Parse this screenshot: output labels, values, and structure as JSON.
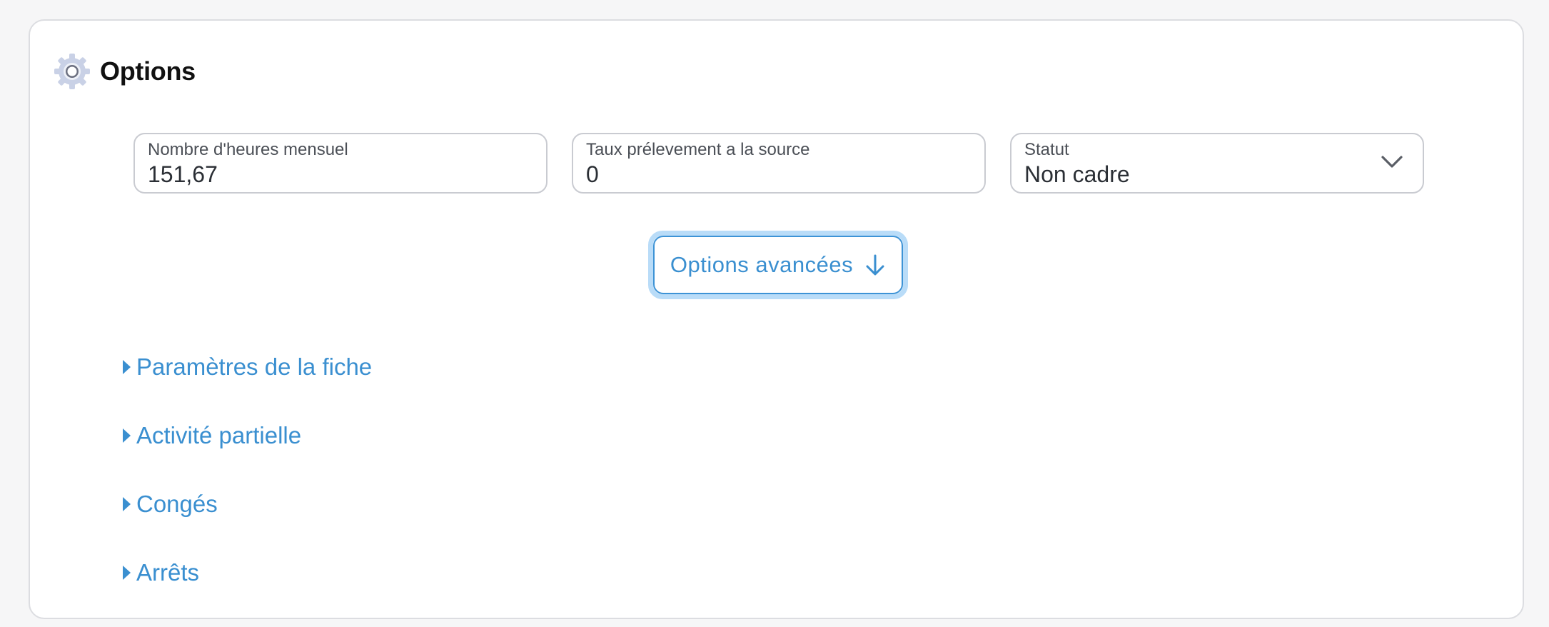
{
  "header": {
    "title": "Options",
    "icon": "gear-icon"
  },
  "fields": [
    {
      "label": "Nombre d'heures mensuel",
      "value": "151,67"
    },
    {
      "label": "Taux prélevement a la source",
      "value": "0"
    },
    {
      "label": "Statut",
      "value": "Non cadre",
      "type": "select"
    }
  ],
  "advanced_button": {
    "label": "Options avancées",
    "icon": "arrow-down-icon"
  },
  "sections": [
    {
      "label": "Paramètres de la fiche"
    },
    {
      "label": "Activité partielle"
    },
    {
      "label": "Congés"
    },
    {
      "label": "Arrêts"
    }
  ],
  "colors": {
    "accent": "#3a8fd0",
    "focus_ring": "#b9dcf8",
    "border": "#c9cbd1"
  }
}
